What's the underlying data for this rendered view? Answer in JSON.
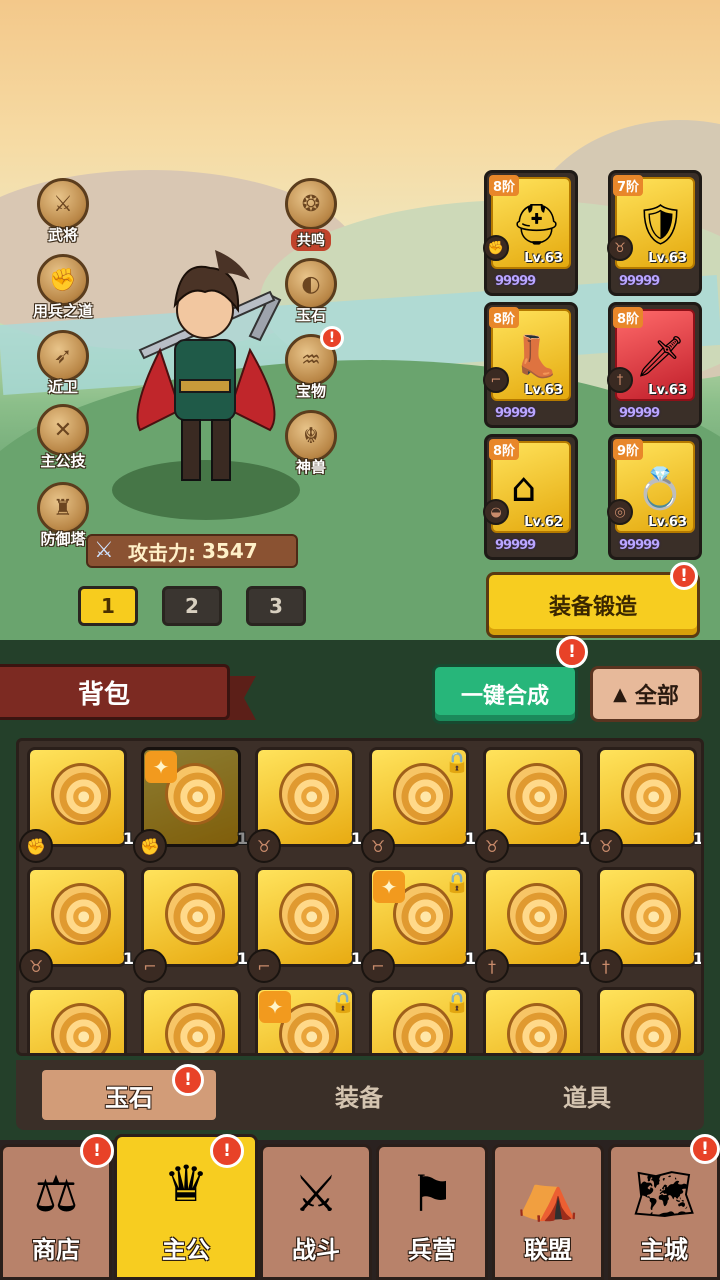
{
  "side_left": [
    {
      "label": "武将",
      "icon": "general-icon"
    },
    {
      "label": "用兵之道",
      "icon": "strategy-icon"
    },
    {
      "label": "近卫",
      "icon": "guard-icon"
    },
    {
      "label": "主公技",
      "icon": "lord-skill-icon"
    },
    {
      "label": "防御塔",
      "icon": "tower-icon"
    }
  ],
  "side_mid": [
    {
      "label": "共鸣",
      "icon": "resonance-icon"
    },
    {
      "label": "玉石",
      "icon": "jade-icon"
    },
    {
      "label": "宝物",
      "icon": "treasure-icon"
    },
    {
      "label": "神兽",
      "icon": "beast-icon"
    }
  ],
  "attack": {
    "label": "攻击力:",
    "value": "3547"
  },
  "pages": [
    "1",
    "2",
    "3"
  ],
  "active_page": "1",
  "equipment": [
    {
      "stage": "8阶",
      "level": "Lv.63",
      "stars": "99999",
      "icon": "helmet-icon",
      "slot": "fist-icon"
    },
    {
      "stage": "7阶",
      "level": "Lv.63",
      "stars": "99999",
      "icon": "armor-icon",
      "slot": "boar-icon"
    },
    {
      "stage": "8阶",
      "level": "Lv.63",
      "stars": "99999",
      "icon": "boots-icon",
      "slot": "boot-icon"
    },
    {
      "stage": "8阶",
      "level": "Lv.63",
      "stars": "99999",
      "icon": "blade-icon",
      "slot": "sword-icon"
    },
    {
      "stage": "8阶",
      "level": "Lv.62",
      "stars": "99999",
      "icon": "bracer-icon",
      "slot": "shell-icon"
    },
    {
      "stage": "9阶",
      "level": "Lv.63",
      "stars": "99999",
      "icon": "ring-icon",
      "slot": "ring-slot-icon"
    }
  ],
  "forge_label": "装备锻造",
  "bag_title": "背包",
  "merge_label": "一键合成",
  "filter_label": "全部",
  "items": [
    {
      "qty": "1",
      "slot": "fist-icon",
      "spark": false,
      "lock": false,
      "dim": false
    },
    {
      "qty": "1",
      "slot": "fist-icon",
      "spark": true,
      "lock": false,
      "dim": true
    },
    {
      "qty": "1",
      "slot": "boar-icon",
      "spark": false,
      "lock": false,
      "dim": false
    },
    {
      "qty": "1",
      "slot": "boar-icon",
      "spark": false,
      "lock": true,
      "dim": false
    },
    {
      "qty": "1",
      "slot": "boar-icon",
      "spark": false,
      "lock": false,
      "dim": false
    },
    {
      "qty": "1",
      "slot": "boar-icon",
      "spark": false,
      "lock": false,
      "dim": false
    },
    {
      "qty": "1",
      "slot": "boar-icon",
      "spark": false,
      "lock": false,
      "dim": false
    },
    {
      "qty": "1",
      "slot": "boot-icon",
      "spark": false,
      "lock": false,
      "dim": false
    },
    {
      "qty": "1",
      "slot": "boot-icon",
      "spark": false,
      "lock": false,
      "dim": false
    },
    {
      "qty": "1",
      "slot": "boot-icon",
      "spark": true,
      "lock": true,
      "dim": false
    },
    {
      "qty": "1",
      "slot": "sword-icon",
      "spark": false,
      "lock": false,
      "dim": false
    },
    {
      "qty": "1",
      "slot": "sword-icon",
      "spark": false,
      "lock": false,
      "dim": false
    },
    {
      "qty": "",
      "slot": "",
      "spark": false,
      "lock": false,
      "dim": false
    },
    {
      "qty": "",
      "slot": "",
      "spark": false,
      "lock": false,
      "dim": false
    },
    {
      "qty": "",
      "slot": "",
      "spark": true,
      "lock": true,
      "dim": false
    },
    {
      "qty": "",
      "slot": "",
      "spark": false,
      "lock": true,
      "dim": false
    },
    {
      "qty": "",
      "slot": "",
      "spark": false,
      "lock": false,
      "dim": false
    },
    {
      "qty": "",
      "slot": "",
      "spark": false,
      "lock": false,
      "dim": false
    }
  ],
  "category_tabs": [
    "玉石",
    "装备",
    "道具"
  ],
  "active_category": "玉石",
  "nav": [
    {
      "label": "商店",
      "icon": "shop-icon",
      "alert": true
    },
    {
      "label": "主公",
      "icon": "lord-icon",
      "alert": true
    },
    {
      "label": "战斗",
      "icon": "battle-icon",
      "alert": false
    },
    {
      "label": "兵营",
      "icon": "barracks-icon",
      "alert": false
    },
    {
      "label": "联盟",
      "icon": "alliance-icon",
      "alert": false
    },
    {
      "label": "主城",
      "icon": "city-icon",
      "alert": true
    }
  ],
  "active_nav": "主公",
  "alert_glyph": "!",
  "colors": {
    "accent": "#f7cd20",
    "alert": "#e84228",
    "merge": "#27b67a",
    "bag_banner": "#7c2a22"
  }
}
